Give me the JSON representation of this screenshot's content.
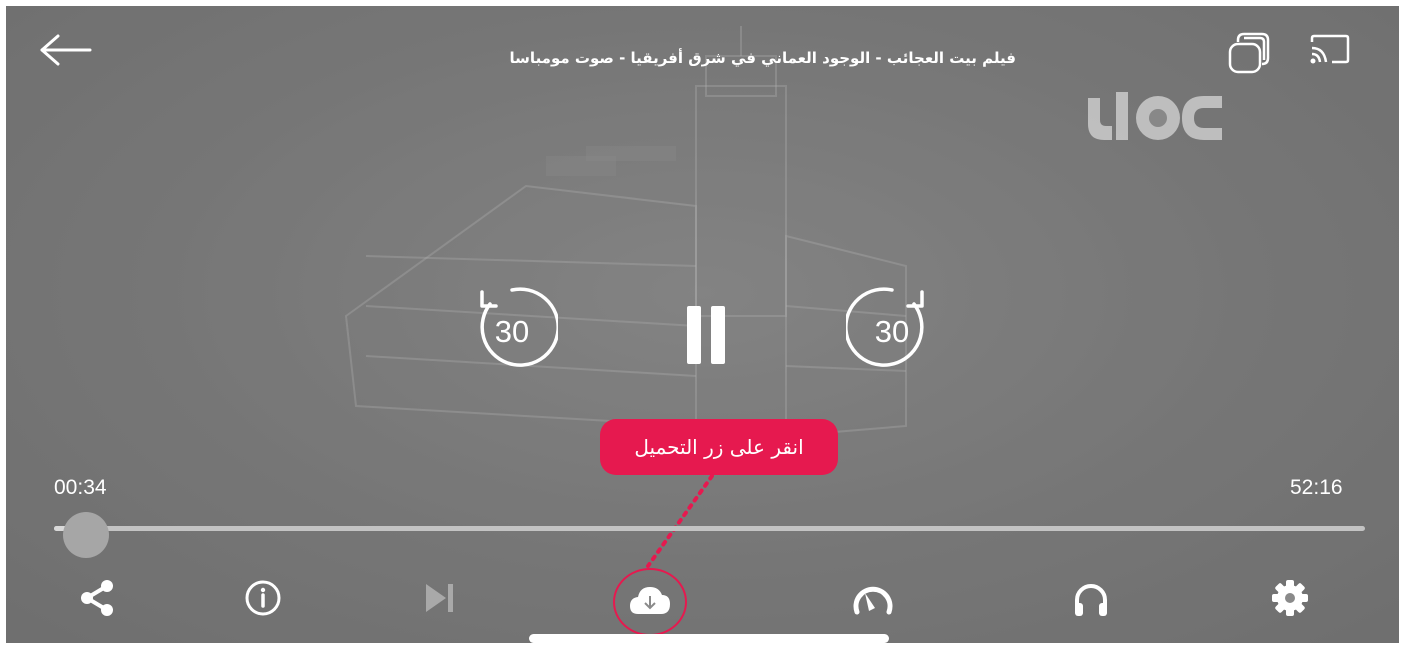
{
  "header": {
    "title": "فيلم بيت العجائب - الوجود العماني في شرق أفريقيا - صوت مومباسا",
    "back_icon": "arrow-left-icon",
    "pip_icon": "stacked-windows-icon",
    "cast_icon": "cast-icon"
  },
  "watermark": {
    "text": "ulac"
  },
  "controls": {
    "rewind_seconds": "30",
    "forward_seconds": "30",
    "pause_icon": "pause-icon"
  },
  "playback": {
    "current_time": "00:34",
    "duration": "52:16",
    "progress_fraction": 0.011
  },
  "tooltip": {
    "text": "انقر على زر التحميل"
  },
  "toolbar": {
    "icons": [
      "share-icon",
      "info-icon",
      "skip-next-icon",
      "cloud-download-icon",
      "speedometer-icon",
      "headphones-icon",
      "gear-icon"
    ]
  },
  "colors": {
    "accent": "#e6194f",
    "foreground": "#ffffff",
    "background": "#808080"
  }
}
